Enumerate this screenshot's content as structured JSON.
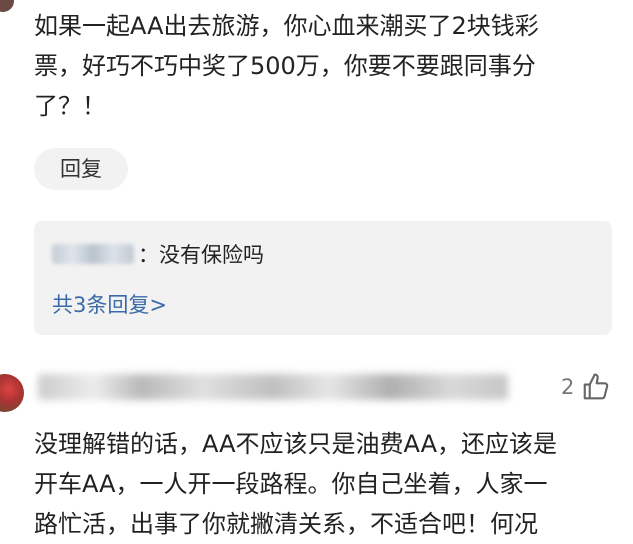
{
  "comment1": {
    "text_lines": [
      "如果一起AA出去旅游，你心血来潮买了2块钱彩",
      "票，好巧不巧中奖了500万，你要不要跟同事分",
      "了？！"
    ],
    "reply_button": "回复"
  },
  "reply_preview": {
    "suffix": "：没有保险吗",
    "more_link": "共3条回复>"
  },
  "comment2": {
    "like_count": "2",
    "text_lines": [
      "没理解错的话，AA不应该只是油费AA，还应该是",
      "开车AA，一人开一段路程。你自己坐着，人家一",
      "路忙活，出事了你就撇清关系，不适合吧！何况"
    ]
  }
}
